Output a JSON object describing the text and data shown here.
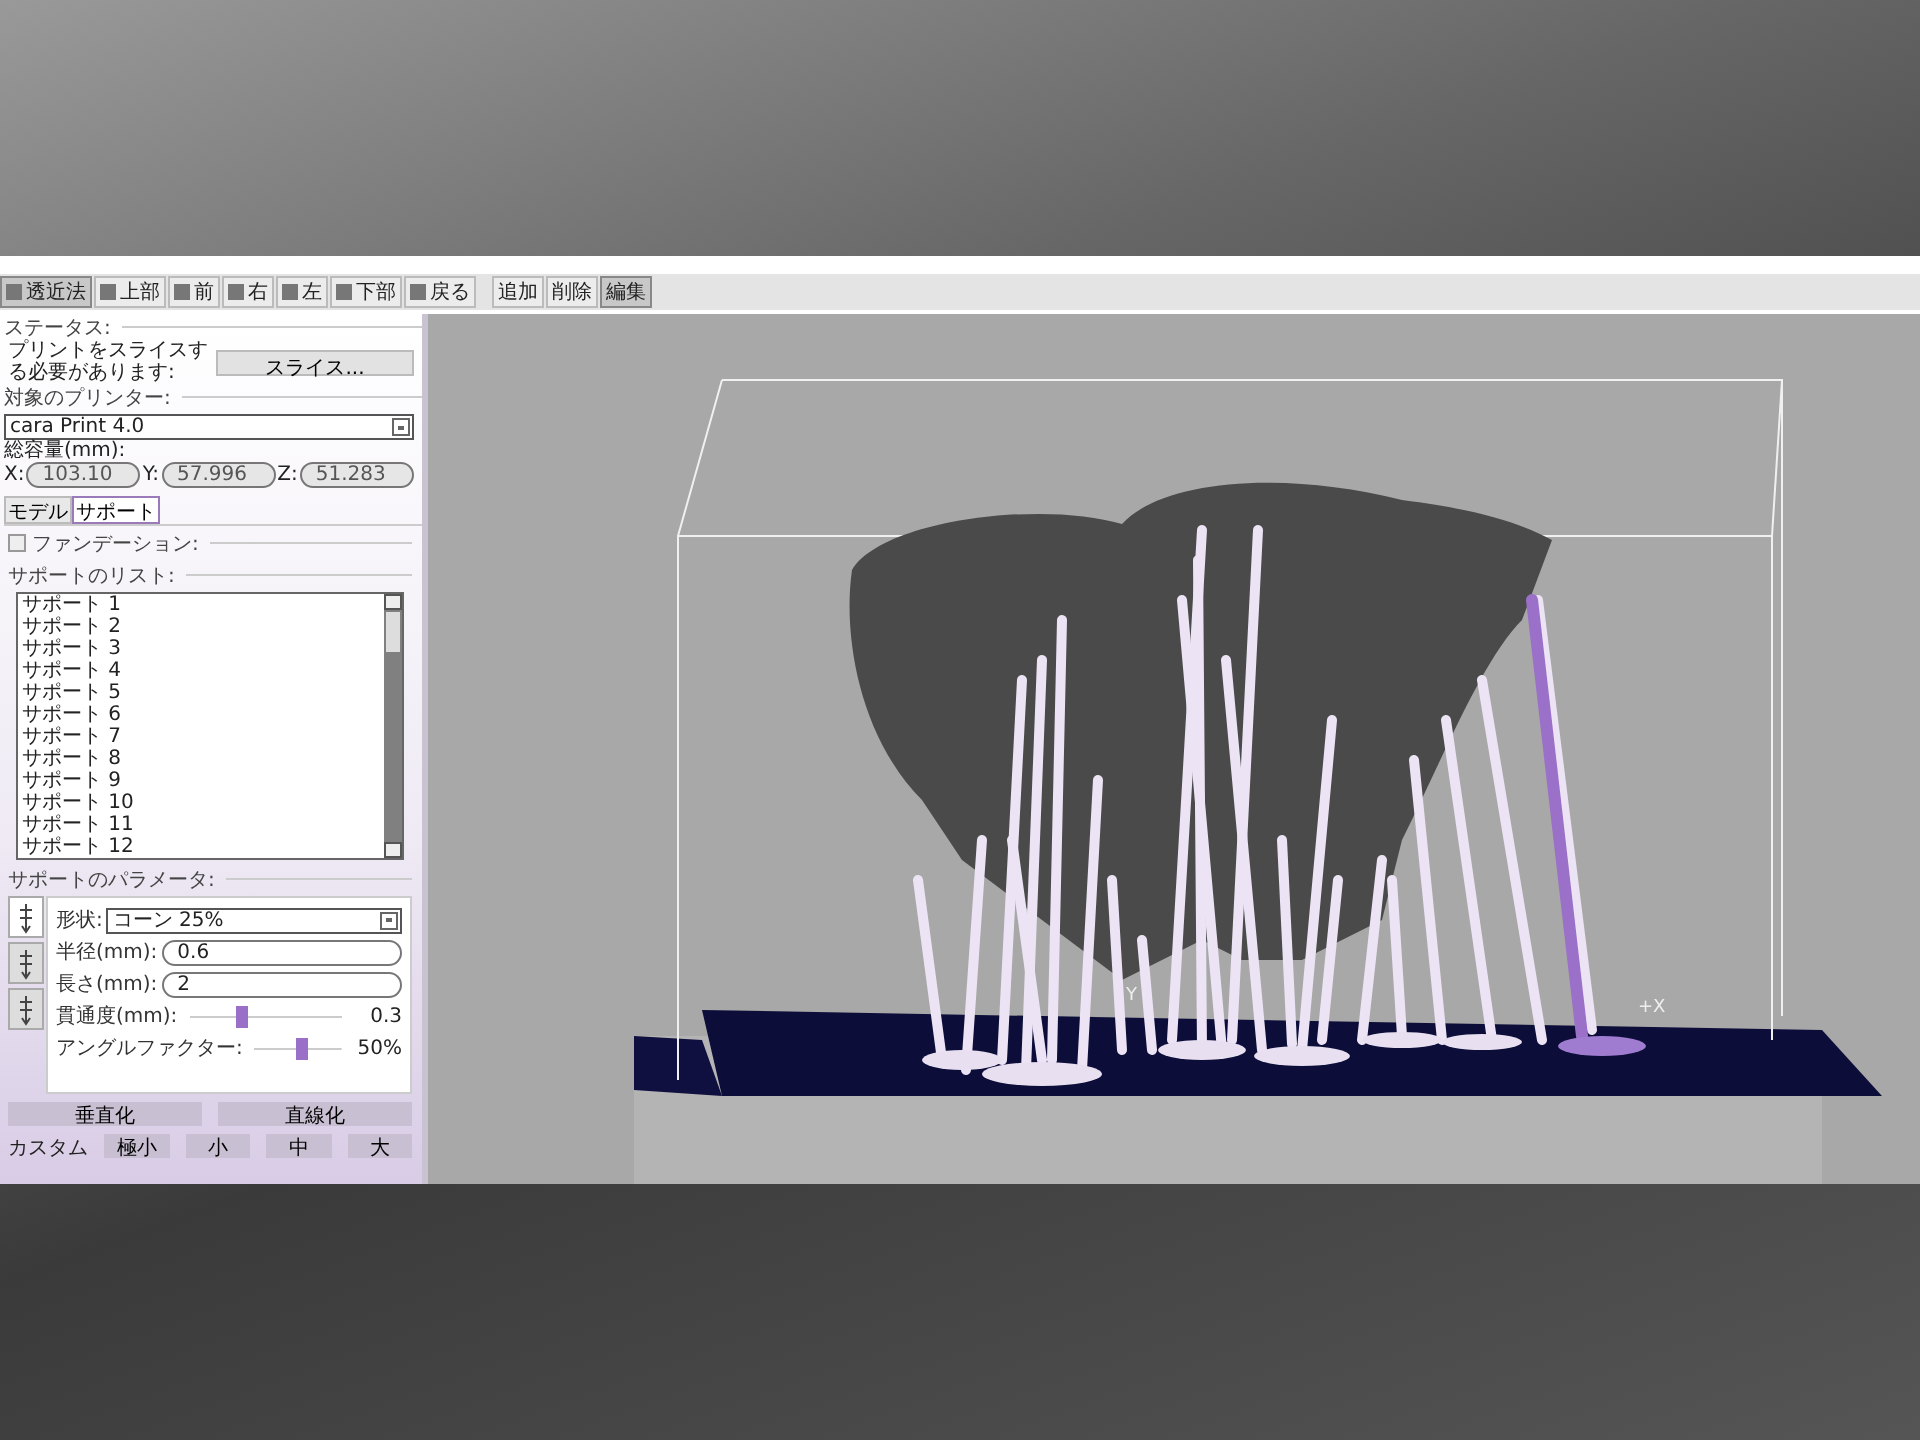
{
  "toolbar": {
    "view_buttons": [
      {
        "label": "透近法",
        "selected": true
      },
      {
        "label": "上部",
        "selected": false
      },
      {
        "label": "前",
        "selected": false
      },
      {
        "label": "右",
        "selected": false
      },
      {
        "label": "左",
        "selected": false
      },
      {
        "label": "下部",
        "selected": false
      },
      {
        "label": "戻る",
        "selected": false
      }
    ],
    "mode_buttons": [
      {
        "label": "追加",
        "selected": false
      },
      {
        "label": "削除",
        "selected": false
      },
      {
        "label": "編集",
        "selected": true
      }
    ]
  },
  "status": {
    "heading": "ステータス:",
    "message": "プリントをスライスする必要があります:",
    "slice_button": "スライス..."
  },
  "printer": {
    "heading": "対象のプリンター:",
    "value": "cara Print 4.0",
    "volume_label": "総容量(mm):",
    "volume": [
      {
        "axis": "X:",
        "value": "103.10"
      },
      {
        "axis": "Y:",
        "value": "57.996"
      },
      {
        "axis": "Z:",
        "value": "51.283"
      }
    ]
  },
  "tabs": [
    {
      "label": "モデル",
      "selected": false
    },
    {
      "label": "サポート",
      "selected": true
    }
  ],
  "foundation": {
    "label": "ファンデーション:",
    "checked": false
  },
  "support_list": {
    "heading": "サポートのリスト:",
    "items": [
      "サポート 1",
      "サポート 2",
      "サポート 3",
      "サポート 4",
      "サポート 5",
      "サポート 6",
      "サポート 7",
      "サポート 8",
      "サポート 9",
      "サポート 10",
      "サポート 11",
      "サポート 12"
    ]
  },
  "parameters": {
    "heading": "サポートのパラメータ:",
    "side_tabs": [
      {
        "selected": true
      },
      {
        "selected": false
      },
      {
        "selected": false
      }
    ],
    "shape": {
      "label": "形状:",
      "value": "コーン 25%"
    },
    "fields": [
      {
        "label": "半径(mm):",
        "value": "0.6"
      },
      {
        "label": "長さ(mm):",
        "value": "2"
      }
    ],
    "sliders": [
      {
        "label": "貫通度(mm):",
        "level": 0.35,
        "reading": "0.3"
      },
      {
        "label": "アングルファクター:",
        "level": 0.55,
        "reading": "50%"
      }
    ]
  },
  "actions": [
    "垂直化",
    "直線化"
  ],
  "size_label": "カスタム",
  "sizes": [
    "極小",
    "小",
    "中",
    "大"
  ],
  "viewport": {
    "axis_labels": [
      "Y",
      "+X"
    ]
  }
}
